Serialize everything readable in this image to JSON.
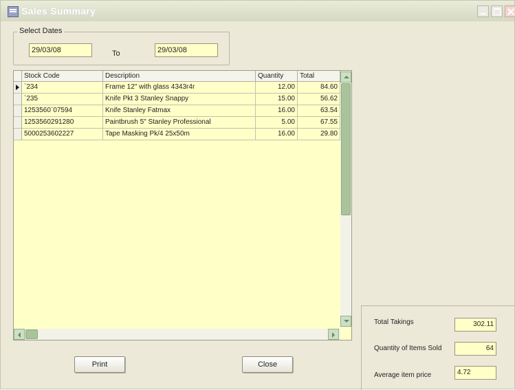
{
  "window": {
    "title": "Sales Summary"
  },
  "dates": {
    "group_label": "Select Dates",
    "from_value": "29/03/08",
    "to_label": "To",
    "to_value": "29/03/08"
  },
  "table": {
    "columns": [
      "Stock Code",
      "Description",
      "Quantity",
      "Total"
    ],
    "rows": [
      [
        "`234",
        "Frame 12\" with glass 4343r4r",
        "12.00",
        "84.60"
      ],
      [
        "`235",
        "Knife Pkt 3 Stanley Snappy",
        "15.00",
        "56.62"
      ],
      [
        "1253560`07594",
        "Knife Stanley Fatmax",
        "16.00",
        "63.54"
      ],
      [
        "1253560291280",
        "Paintbrush 5\" Stanley Professional",
        "5.00",
        "67.55"
      ],
      [
        "5000253602227",
        "Tape Masking Pk/4 25x50m",
        "16.00",
        "29.80"
      ]
    ]
  },
  "buttons": {
    "print": "Print",
    "close": "Close"
  },
  "summary": {
    "total_takings_label": "Total Takings",
    "total_takings_value": "302.11",
    "quantity_label": "Quantity of Items Sold",
    "quantity_value": "64",
    "average_label": "Average item price",
    "average_value": "4.72"
  }
}
